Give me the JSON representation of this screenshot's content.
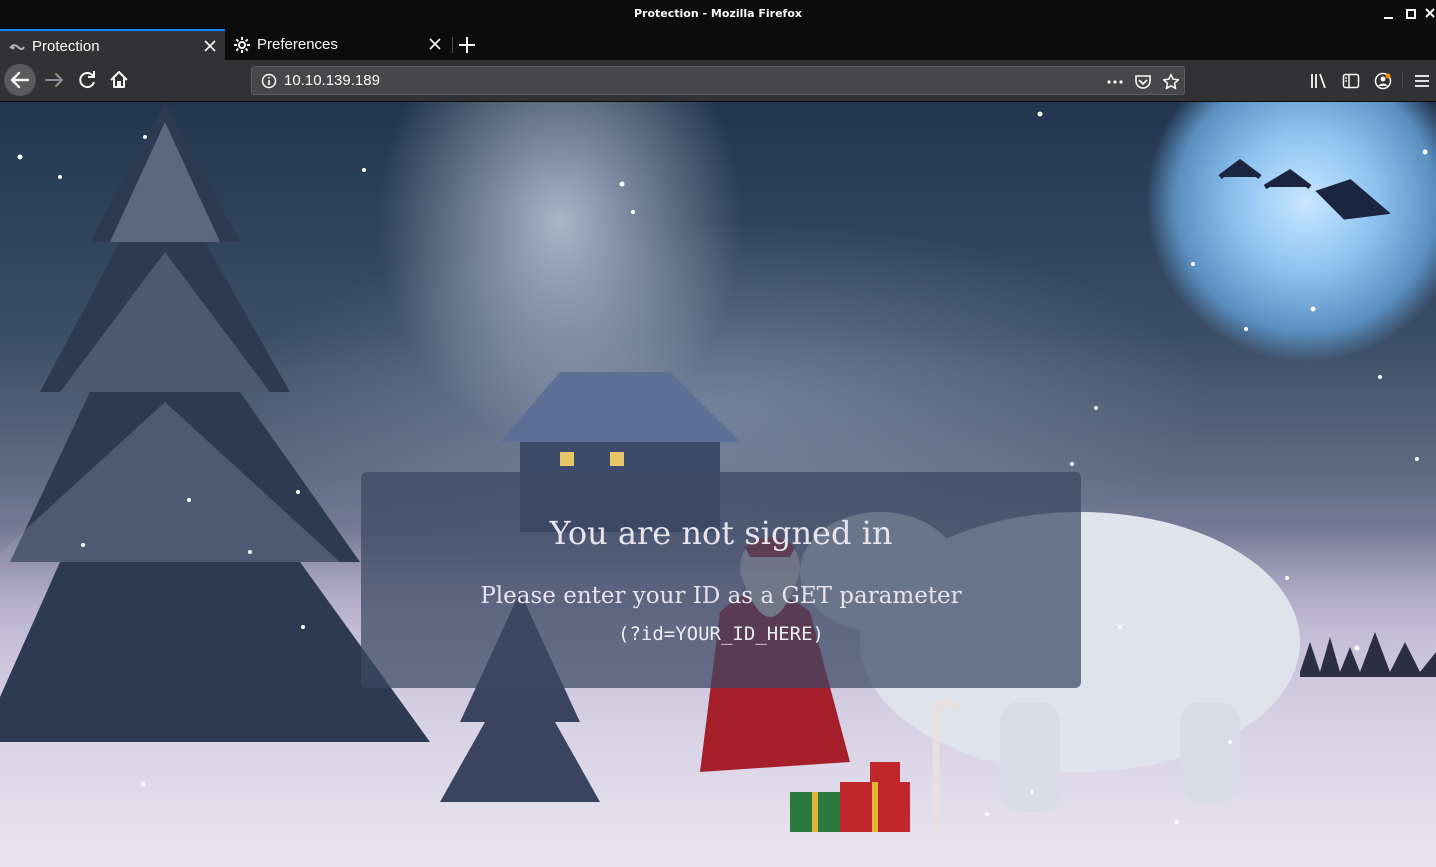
{
  "window": {
    "title": "Protection - Mozilla Firefox"
  },
  "tabs": [
    {
      "label": "Protection",
      "active": true,
      "icon": "page-favicon-icon"
    },
    {
      "label": "Preferences",
      "active": false,
      "icon": "gear-icon"
    }
  ],
  "navbar": {
    "url": "10.10.139.189",
    "icons": [
      "back-arrow-icon",
      "forward-arrow-icon",
      "reload-icon",
      "home-icon",
      "site-info-icon",
      "page-actions-icon",
      "pocket-icon",
      "bookmark-star-icon",
      "library-icon",
      "sidebar-icon",
      "account-icon",
      "hamburger-menu-icon"
    ]
  },
  "page": {
    "heading": "You are not signed in",
    "message": "Please enter your ID as a GET parameter",
    "hint": "(?id=YOUR_ID_HERE)"
  },
  "colors": {
    "accent": "#0a84ff",
    "toolbar": "#323234",
    "urlbar": "#474749",
    "titlebar": "#0c0c0d"
  }
}
